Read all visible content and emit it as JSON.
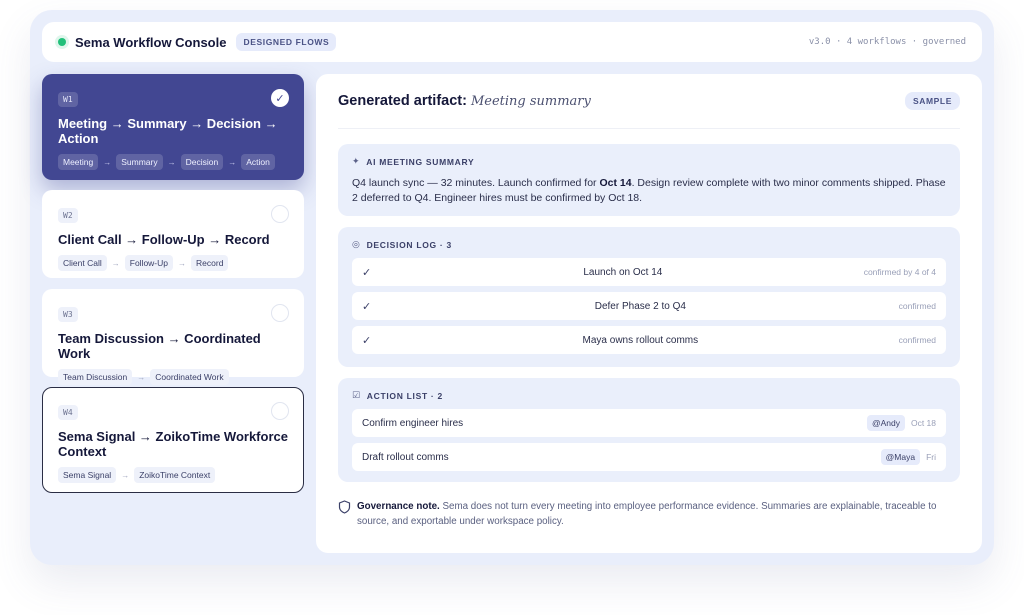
{
  "header": {
    "title": "Sema Workflow Console",
    "badge": "DESIGNED FLOWS",
    "version_info": "v3.0 · 4 workflows · governed"
  },
  "workflows": [
    {
      "tag": "W1",
      "title": "Meeting → Summary → Decision → Action",
      "steps": [
        "Meeting",
        "Summary",
        "Decision",
        "Action"
      ],
      "selected": true
    },
    {
      "tag": "W2",
      "title": "Client Call → Follow-Up → Record",
      "steps": [
        "Client Call",
        "Follow-Up",
        "Record"
      ],
      "selected": false
    },
    {
      "tag": "W3",
      "title": "Team Discussion → Coordinated Work",
      "steps": [
        "Team Discussion",
        "Coordinated Work"
      ],
      "selected": false
    },
    {
      "tag": "W4",
      "title": "Sema Signal → ZoikoTime Workforce Context",
      "steps": [
        "Sema Signal",
        "ZoikoTime Context"
      ],
      "selected": false
    }
  ],
  "artifact": {
    "label": "Generated artifact:",
    "name": "Meeting summary",
    "badge": "SAMPLE"
  },
  "summary": {
    "heading": "AI MEETING SUMMARY",
    "text_before": "Q4 launch sync — 32 minutes. Launch confirmed for ",
    "text_bold": "Oct 14",
    "text_after": ". Design review complete with two minor comments shipped. Phase 2 deferred to Q4. Engineer hires must be confirmed by Oct 18."
  },
  "decision_log": {
    "heading": "DECISION LOG · 3",
    "items": [
      {
        "text": "Launch on Oct 14",
        "meta": "confirmed by 4 of 4"
      },
      {
        "text": "Defer Phase 2 to Q4",
        "meta": "confirmed"
      },
      {
        "text": "Maya owns rollout comms",
        "meta": "confirmed"
      }
    ]
  },
  "action_list": {
    "heading": "ACTION LIST · 2",
    "items": [
      {
        "text": "Confirm engineer hires",
        "owner": "@Andy",
        "due": "Oct 18"
      },
      {
        "text": "Draft rollout comms",
        "owner": "@Maya",
        "due": "Fri"
      }
    ]
  },
  "governance": {
    "title": "Governance note.",
    "text": " Sema does not turn every meeting into employee performance evidence. Summaries are explainable, traceable to source, and exportable under workspace policy."
  },
  "colors": {
    "accent": "#424792",
    "status_online": "#22c07a",
    "panel_bg": "#e9eefb"
  },
  "icons": {
    "status": "status-dot",
    "selected": "check-icon",
    "summary": "sparkle-icon",
    "decision": "target-icon",
    "action": "checkbox-icon",
    "governance": "shield-icon"
  }
}
